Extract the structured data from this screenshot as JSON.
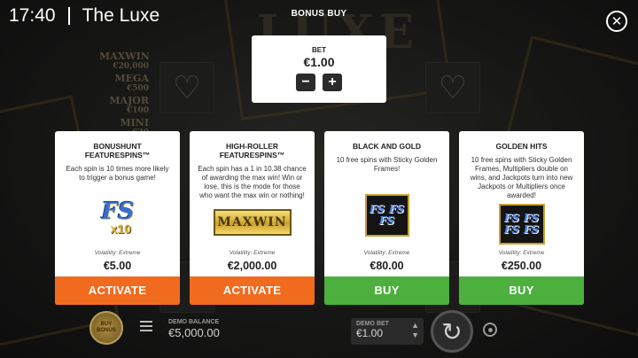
{
  "status": {
    "time": "17:40",
    "game_title": "The Luxe"
  },
  "background": {
    "logo": "LUXE",
    "paytable": [
      {
        "name": "MAXWIN",
        "value": "€20,000"
      },
      {
        "name": "MEGA",
        "value": "€500"
      },
      {
        "name": "MAJOR",
        "value": "€100"
      },
      {
        "name": "MINI",
        "value": "€20"
      }
    ]
  },
  "header": {
    "title": "BONUS BUY",
    "close_icon": "close-icon"
  },
  "bet": {
    "label": "BET",
    "value": "€1.00",
    "minus": "−",
    "plus": "+"
  },
  "cards": [
    {
      "title": "BONUSHUNT FEATURESPINS™",
      "description": "Each spin is 10 times more likely to trigger a bonus game!",
      "art": {
        "main": "FS",
        "sub": "x10"
      },
      "volatility": "Volatility: Extreme",
      "price": "€5.00",
      "action": "ACTIVATE",
      "action_color": "#f16b1f"
    },
    {
      "title": "HIGH-ROLLER FEATURESPINS™",
      "description": "Each spin has a 1 in 10.38 chance of awarding the max win! Win or lose, this is the mode for those who want the max win or nothing!",
      "art": {
        "main": "MAXWIN"
      },
      "volatility": "Volatility: Extreme",
      "price": "€2,000.00",
      "action": "ACTIVATE",
      "action_color": "#f16b1f"
    },
    {
      "title": "BLACK AND GOLD",
      "description": "10 free spins with Sticky Golden Frames!",
      "art": {
        "marks": [
          "FS",
          "FS",
          "FS"
        ]
      },
      "volatility": "Volatility: Extreme",
      "price": "€80.00",
      "action": "BUY",
      "action_color": "#4caf3e"
    },
    {
      "title": "GOLDEN HITS",
      "description": "10 free spins with Sticky Golden Frames, Multipliers double on wins, and Jackpots turn into new Jackpots or Multipliers once awarded!",
      "art": {
        "marks": [
          "FS",
          "FS",
          "FS",
          "FS"
        ]
      },
      "volatility": "Volatility: Extreme",
      "price": "€250.00",
      "action": "BUY",
      "action_color": "#4caf3e"
    }
  ],
  "footer": {
    "buy_bonus_label": "BUY BONUS",
    "demo_balance_label": "DEMO BALANCE",
    "demo_balance": "€5,000.00",
    "demo_bet_label": "DEMO BET",
    "demo_bet": "€1.00"
  }
}
